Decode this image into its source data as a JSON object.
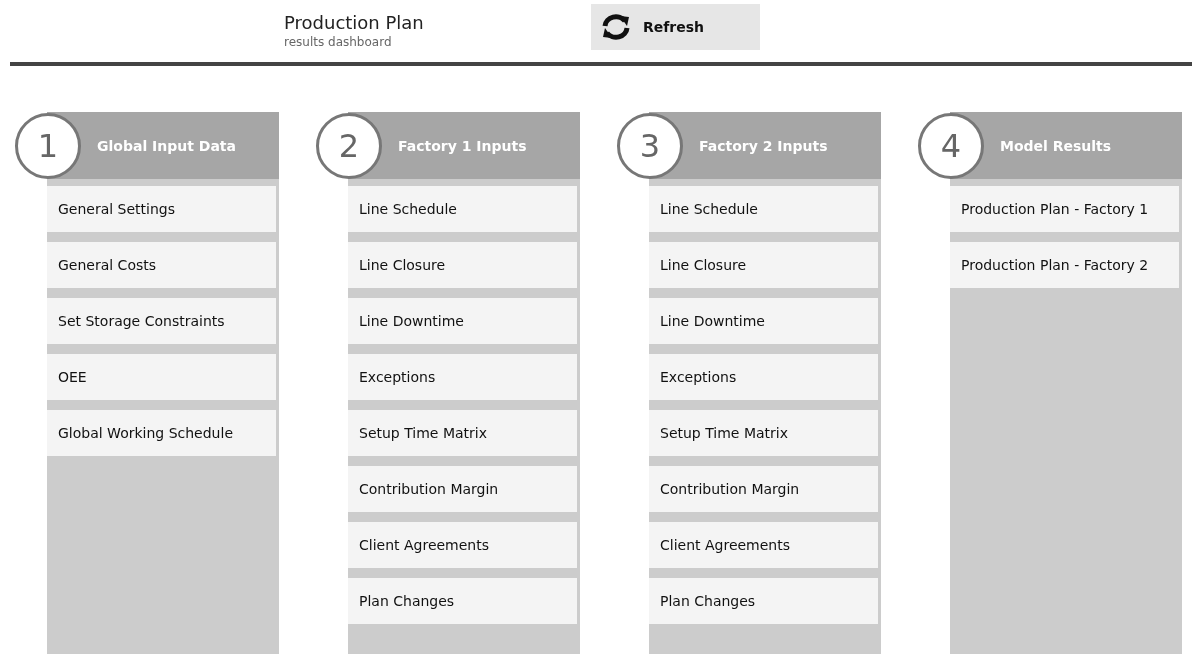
{
  "header": {
    "title": "Production Plan",
    "subtitle": "results dashboard",
    "refresh_button": "Refresh"
  },
  "columns": [
    {
      "number": "1",
      "title": "Global Input Data",
      "items": [
        "General Settings",
        "General Costs",
        "Set Storage Constraints",
        "OEE",
        "Global Working Schedule"
      ]
    },
    {
      "number": "2",
      "title": "Factory 1 Inputs",
      "items": [
        "Line Schedule",
        "Line Closure",
        "Line Downtime",
        "Exceptions",
        "Setup Time Matrix",
        "Contribution Margin",
        "Client Agreements",
        "Plan Changes"
      ]
    },
    {
      "number": "3",
      "title": "Factory 2 Inputs",
      "items": [
        "Line Schedule",
        "Line Closure",
        "Line Downtime",
        "Exceptions",
        "Setup Time Matrix",
        "Contribution Margin",
        "Client Agreements",
        "Plan Changes"
      ]
    },
    {
      "number": "4",
      "title": "Model Results",
      "items": [
        "Production Plan - Factory 1",
        "Production Plan - Factory 2"
      ]
    }
  ]
}
